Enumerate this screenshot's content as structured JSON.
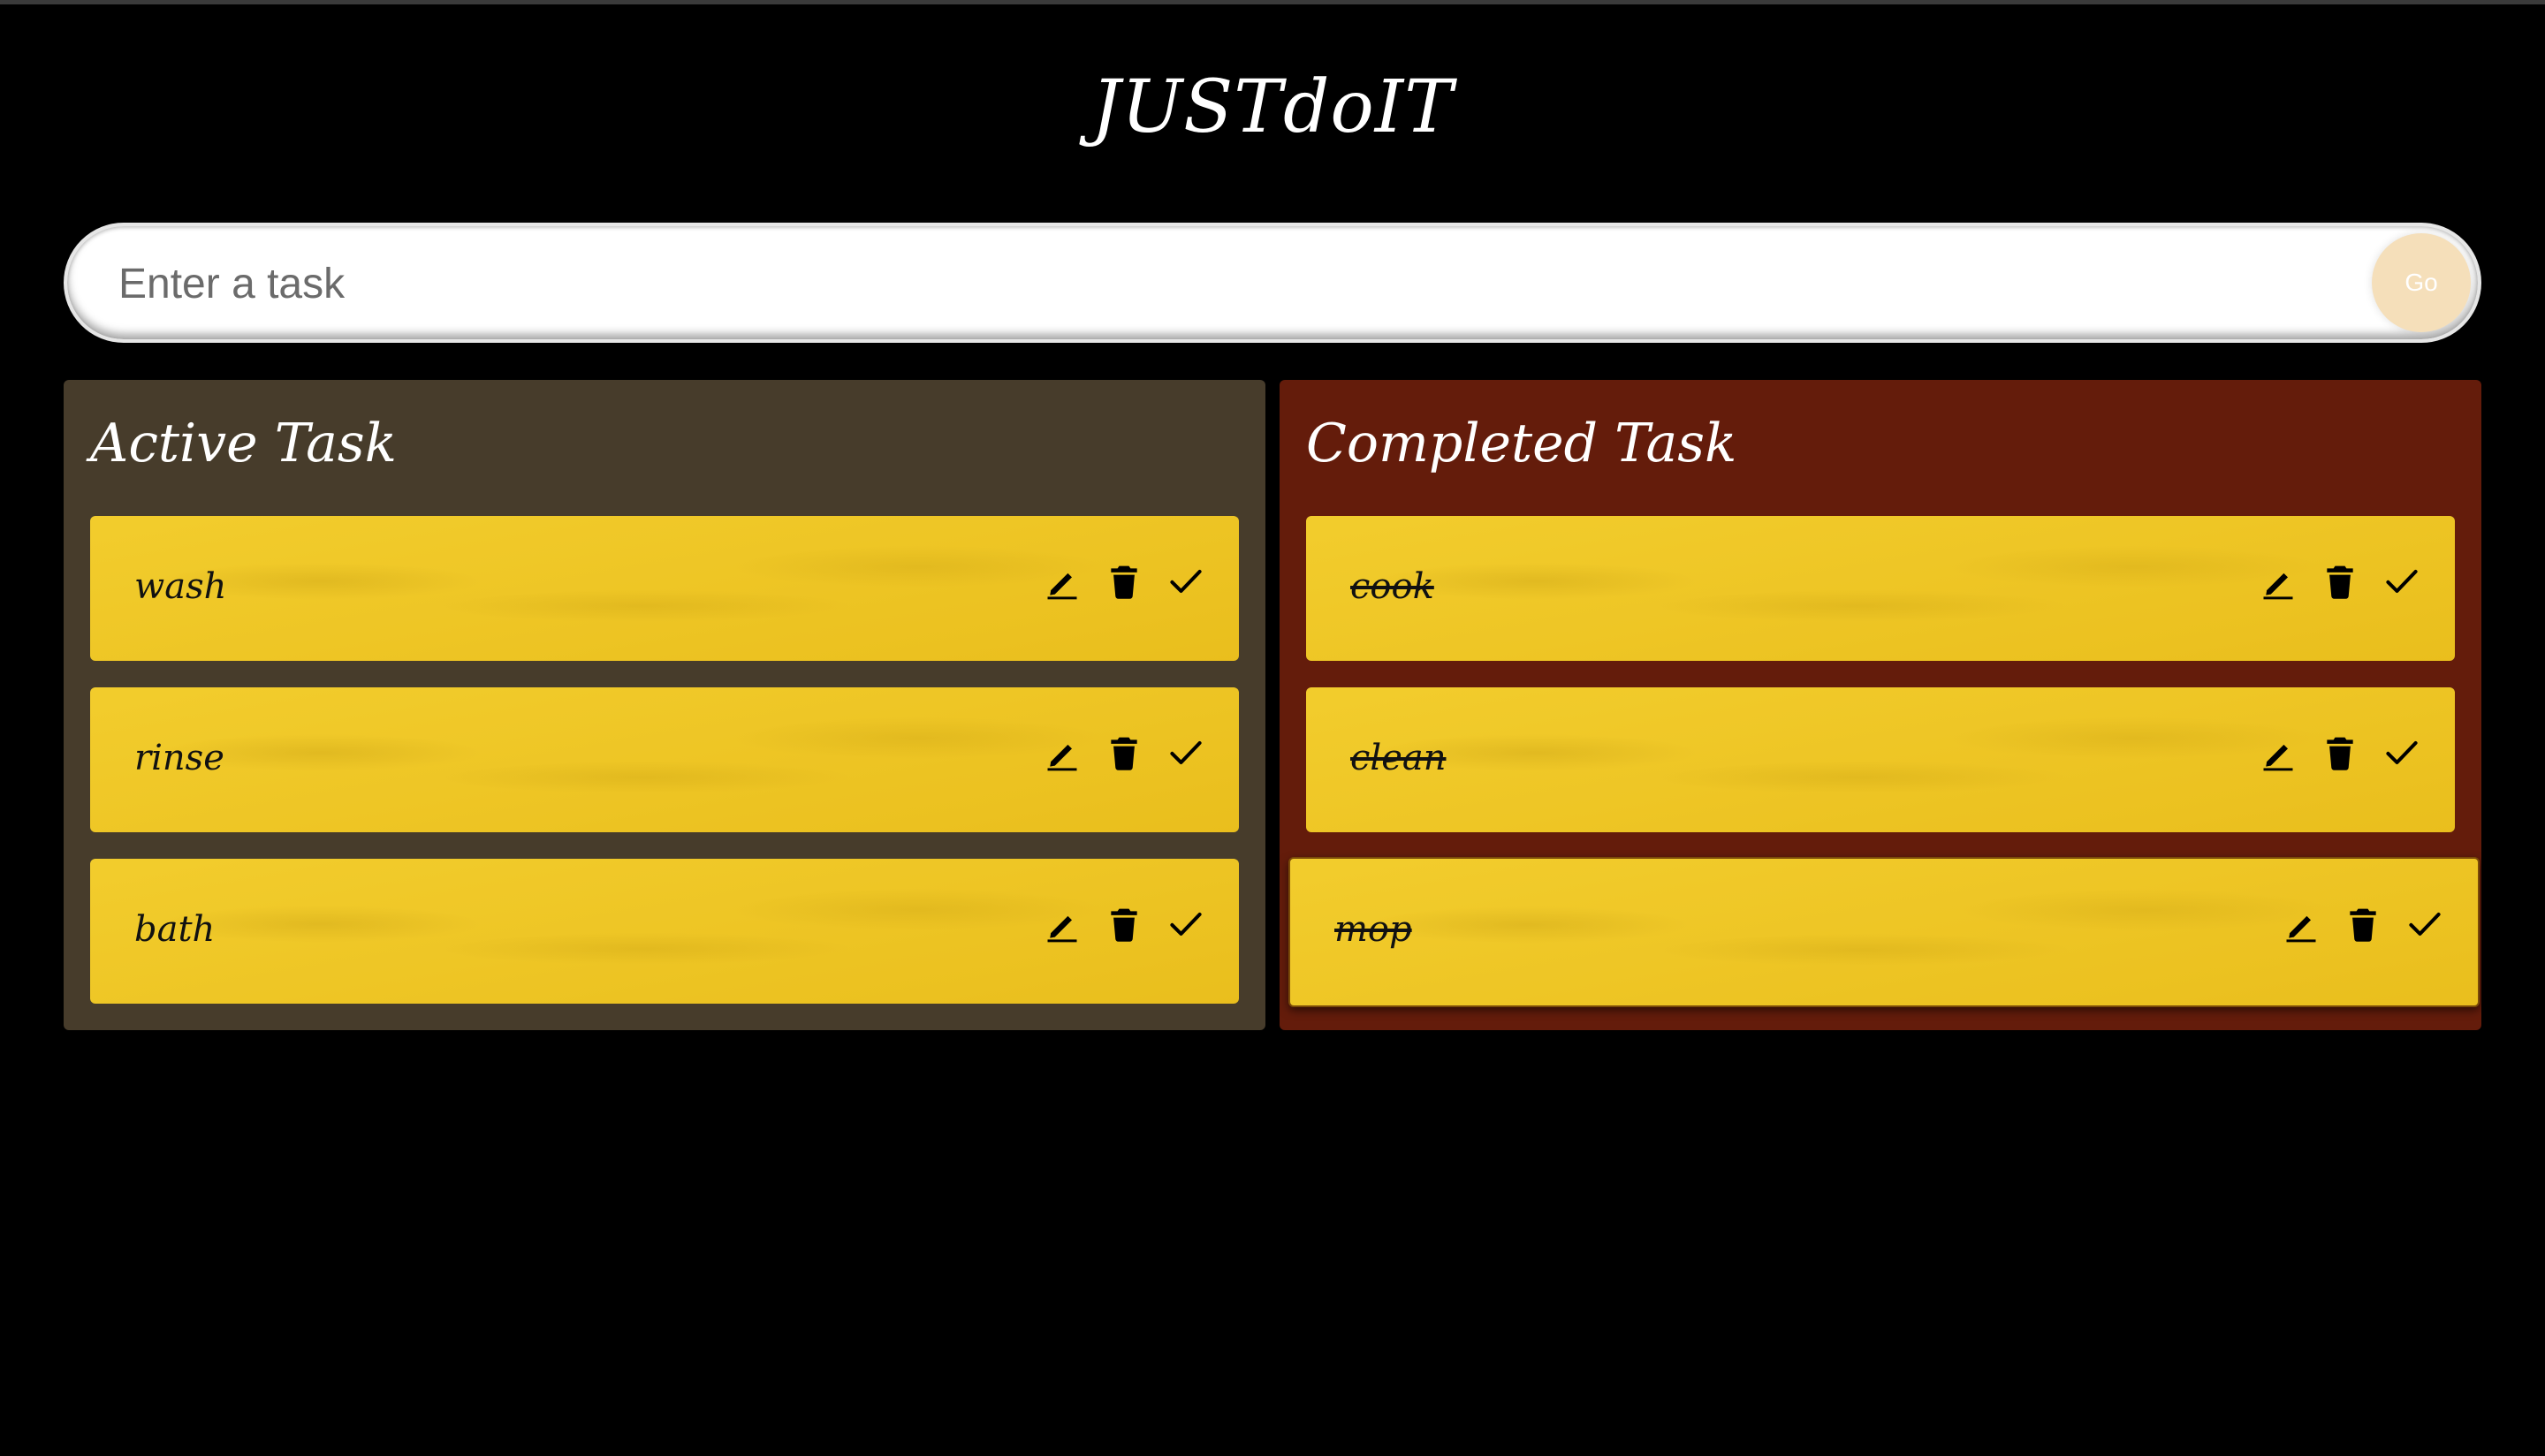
{
  "app": {
    "title": "JUSTdoIT"
  },
  "form": {
    "placeholder": "Enter a task",
    "go_label": "Go"
  },
  "active": {
    "heading": "Active Task",
    "tasks": [
      {
        "label": "wash"
      },
      {
        "label": "rinse"
      },
      {
        "label": "bath"
      }
    ]
  },
  "completed": {
    "heading": "Completed Task",
    "tasks": [
      {
        "label": "cook"
      },
      {
        "label": "clean"
      },
      {
        "label": "mop"
      }
    ]
  },
  "icons": {
    "edit": "pencil-icon",
    "delete": "trash-icon",
    "done": "check-icon"
  },
  "colors": {
    "background": "#000000",
    "active_panel": "#473c2b",
    "completed_panel": "#641c0b",
    "card": "#eec421",
    "go_button": "#f5dfba"
  }
}
